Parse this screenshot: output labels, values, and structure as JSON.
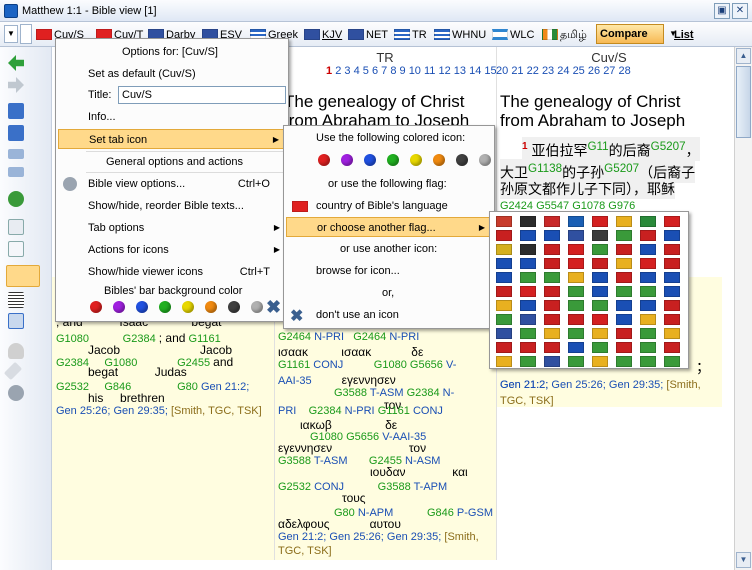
{
  "window": {
    "title": "Matthew 1:1 - Bible view [1]"
  },
  "tabs": [
    {
      "label": "Cuv/S",
      "flag": "#e02020"
    },
    {
      "label": "Cuv/T",
      "flag": "#e02020"
    },
    {
      "label": "Darby",
      "flag": "#3050a0"
    },
    {
      "label": "ESV",
      "flag": "#3050a0"
    },
    {
      "label": "Greek",
      "flag": "#2a66c4"
    },
    {
      "label": "KJV",
      "flag": "#3050a0"
    },
    {
      "label": "NET",
      "flag": "#3050a0"
    },
    {
      "label": "TR",
      "flag": "#2a66c4"
    },
    {
      "label": "WHNU",
      "flag": "#2a66c4"
    },
    {
      "label": "WLC",
      "flag": "#2f86d0"
    },
    {
      "label": "தமிழ்",
      "flag": "#f08a1a"
    }
  ],
  "compare": "Compare",
  "list": "List",
  "columns": {
    "tr": {
      "header": "TR",
      "verses": [
        "1",
        "2",
        "3",
        "4",
        "5",
        "6",
        "7",
        "8",
        "9",
        "10",
        "11",
        "12",
        "13",
        "14",
        "15",
        "16",
        "17",
        "18",
        "19"
      ],
      "heading_line1": "The genealogy of Christ",
      "heading_line2": "from Abraham to Joseph"
    },
    "cuv": {
      "header": "Cuv/S",
      "verses": [
        "20",
        "21",
        "22",
        "23",
        "24",
        "25",
        "26",
        "27",
        "28"
      ],
      "heading_line1": "The genealogy of Christ",
      "heading_line2": "from Abraham to Joseph",
      "vnum": "1",
      "text1": "亚伯拉罕",
      "s1": "G11",
      "text2": "的后裔",
      "s2": "G5207",
      "text3": "，",
      "text4": "大卫",
      "s3": "G1138",
      "text5": "的子孙",
      "s4": "G5207",
      "text6": "（后裔子",
      "text7": "孙原文都作儿子下同），耶稣",
      "s5": "G2424",
      "s6": "G5547",
      "s7": "G1078",
      "s8": "G976",
      "tail1": "祖",
      "tail2": "的弟兄",
      "tail3": "；",
      "ref1": "Gen 21:2;",
      "ref2": "Gen 25:26;",
      "ref3": "Gen 29:35;",
      "note": "[Smith,",
      "note2": "TGC, TSK]"
    }
  },
  "kjv_fragment": {
    "w1": "; and",
    "w2": "Isaac",
    "w3": "begat",
    "s1": "G1080",
    "s2": "G2384",
    "w4": "; and",
    "s3": "G1161",
    "w5": "Jacob",
    "w6": "Jacob",
    "s4": "G2384",
    "s5": "G1080",
    "s6": "G2455",
    "w7": "and",
    "w8": "begat",
    "w9": "Judas",
    "s7": "G2532",
    "s8": "G846",
    "s9": "G80",
    "r1": "Gen 21:2;",
    "w10": "his",
    "w11": "brethren",
    "r2": "Gen 25:26;",
    "r3": "Gen 29:35;",
    "r4": "[Smith, TGC, TSK]"
  },
  "greek": {
    "l1a": "G2464",
    "l1b": "N-PRI",
    "l1c": "G2464",
    "l1d": "N-PRI",
    "w1": "ισαακ",
    "w2": "ισαακ",
    "w3": "δε",
    "l2a": "G1161",
    "l2b": "CONJ",
    "l2c": "G1080",
    "l2d": "G5656",
    "l2e": "V-",
    "l3a": "AAI-35",
    "w4": "εγεννησεν",
    "l3b": "G3588",
    "l3c": "T-ASM",
    "l3d": "G2384",
    "l3e": "N-",
    "w5": "τον",
    "l4a": "PRI",
    "l4b": "G2384",
    "l4c": "N-PRI",
    "l4d": "G1161",
    "l4e": "CONJ",
    "w6": "ιακωβ",
    "w7": "ιακωβ",
    "w8": "δε",
    "l5a": "G1080",
    "l5b": "G5656",
    "l5c": "V-AAI-35",
    "w9": "εγεννησεν",
    "w10": "τον",
    "l6a": "G3588",
    "l6b": "T-ASM",
    "l6c": "G2455",
    "l6d": "N-ASM",
    "w11": "ιουδαν",
    "w12": "και",
    "l7a": "G2532",
    "l7b": "CONJ",
    "l7c": "G3588",
    "l7d": "T-APM",
    "w13": "τους",
    "l8a": "G80",
    "l8b": "N-APM",
    "l8c": "G846",
    "l8d": "P-GSM",
    "w14": "αδελφους",
    "w15": "αυτου",
    "r1": "Gen 21:2;",
    "r2": "Gen 25:26;",
    "r3": "Gen 29:35;",
    "r4": "[Smith,",
    "r5": "TGC, TSK]"
  },
  "menu": {
    "header": "Options for: [Cuv/S]",
    "set_default": "Set as default (Cuv/S)",
    "title_label": "Title:",
    "title_value": "Cuv/S",
    "info": "Info...",
    "set_tab_icon": "Set tab icon",
    "general_header": "General options and actions",
    "bible_view_options": "Bible view options...",
    "bible_view_shortcut": "Ctrl+O",
    "showhide_texts": "Show/hide, reorder Bible texts...",
    "tab_options": "Tab options",
    "actions_for_icons": "Actions for icons",
    "showhide_icons": "Show/hide viewer icons",
    "showhide_shortcut": "Ctrl+T",
    "bar_bg_color": "Bibles' bar background color"
  },
  "submenu": {
    "use_colored": "Use the following colored icon:",
    "use_flag": "or use the following flag:",
    "country_flag": "country of Bible's language",
    "choose_flag": "or choose another flag...",
    "use_another": "or use another icon:",
    "browse": "browse for icon...",
    "or": "or,",
    "dont_use": "don't use an icon"
  },
  "colors": {
    "dots": [
      "#e02020",
      "#a020e0",
      "#2050e0",
      "#20b020",
      "#e8d800",
      "#f08a10",
      "#404040",
      "#b0b0b0"
    ],
    "highlight": "#ffd98a",
    "yellow_bg": "#fffde0"
  },
  "flags": [
    "#c83c2c",
    "#2c2c2c",
    "#c82828",
    "#1a5fb4",
    "#d42020",
    "#e8b020",
    "#2a8a3a",
    "#d42020",
    "#c82020",
    "#1a4fb4",
    "#1a4fb4",
    "#3050a0",
    "#3a3a3a",
    "#3a9a3a",
    "#c82020",
    "#1a4fb4",
    "#d4b020",
    "#2c2c2c",
    "#c82020",
    "#d42020",
    "#3a9a3a",
    "#c82020",
    "#1a4fb4",
    "#c82020",
    "#1a4fb4",
    "#1a4fb4",
    "#c82020",
    "#d42020",
    "#c82020",
    "#e8b020",
    "#d42020",
    "#c82020",
    "#1a4fb4",
    "#3a9a3a",
    "#3a9a3a",
    "#e8b020",
    "#1a4fb4",
    "#c82020",
    "#1a4fb4",
    "#1a4fb4",
    "#c82020",
    "#d42020",
    "#c82020",
    "#3a9a3a",
    "#1a4fb4",
    "#3a9a3a",
    "#3a9a3a",
    "#1a4fb4",
    "#e8b020",
    "#1a4fb4",
    "#c82020",
    "#3a9a3a",
    "#3a9a3a",
    "#1a4fb4",
    "#1a4fb4",
    "#c82020",
    "#3a9a3a",
    "#3050a0",
    "#c82020",
    "#c82020",
    "#d42020",
    "#1a4fb4",
    "#e8b020",
    "#c82020",
    "#3050a0",
    "#3a9a3a",
    "#e8b020",
    "#3a9a3a",
    "#e8b020",
    "#c82020",
    "#3a9a3a",
    "#e8b020",
    "#c82020",
    "#c82020",
    "#c82020",
    "#1a4fb4",
    "#3a9a3a",
    "#c82020",
    "#3a9a3a",
    "#c82020",
    "#e8b020",
    "#3a9a3a",
    "#3050a0",
    "#3a9a3a",
    "#e8b020",
    "#3a9a3a",
    "#3a9a3a",
    "#3a9a3a"
  ]
}
